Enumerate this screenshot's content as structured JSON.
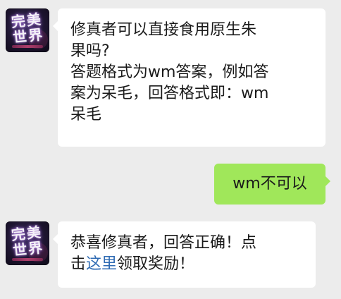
{
  "chat": {
    "bot": {
      "avatar_text": "完美世界",
      "avatar_icon": "game-logo-icon"
    },
    "messages": [
      {
        "sender": "bot",
        "lines": [
          "修真者可以直接食用原生朱",
          "果吗?",
          "答题格式为wm答案，例如答",
          "案为呆毛，回答格式即：wm",
          "呆毛"
        ]
      },
      {
        "sender": "user",
        "text": "wm不可以"
      },
      {
        "sender": "bot",
        "line1": "恭喜修真者，回答正确！点",
        "line2_before": "击",
        "link": "这里",
        "line2_after": "领取奖励！"
      }
    ]
  },
  "colors": {
    "background": "#ececec",
    "bot_bubble": "#ffffff",
    "user_bubble": "#a0e75a",
    "link": "#2f6bb3"
  }
}
